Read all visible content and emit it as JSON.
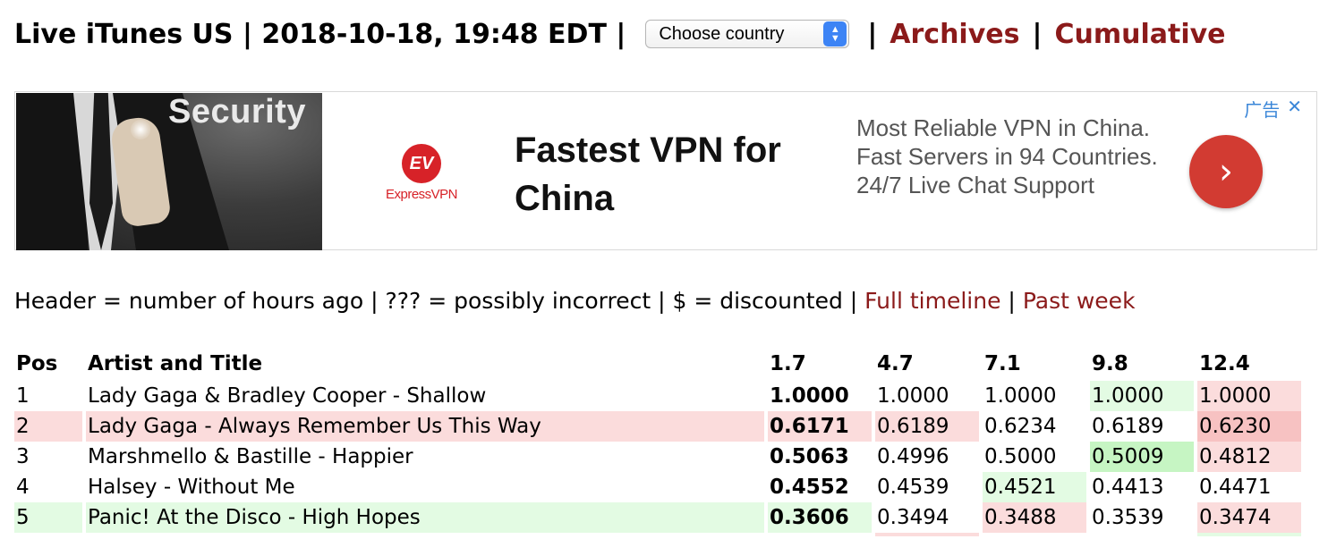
{
  "header": {
    "title": "Live iTunes US | 2018-10-18, 19:48 EDT |",
    "country_select": "Choose country",
    "sep": "|",
    "archives": "Archives",
    "cumulative": "Cumulative"
  },
  "ad": {
    "image_text": "Security",
    "brand_mark": "EV",
    "brand_name": "ExpressVPN",
    "headline": "Fastest VPN for China",
    "body": "Most Reliable VPN in China. Fast Servers in 94 Countries. 24/7 Live Chat Support",
    "cta_glyph": "›",
    "ad_label": "广告",
    "close_glyph": "✕"
  },
  "legend": {
    "text": "Header = number of hours ago | ??? = possibly incorrect | $ = discounted |",
    "full_timeline": "Full timeline",
    "sep": "|",
    "past_week": "Past week"
  },
  "table": {
    "headers": [
      "Pos",
      "Artist and Title",
      "1.7",
      "4.7",
      "7.1",
      "9.8",
      "12.4"
    ],
    "rows": [
      {
        "pos": "1",
        "title": "Lady Gaga & Bradley Cooper - Shallow",
        "values": [
          "1.0000",
          "1.0000",
          "1.0000",
          "1.0000",
          "1.0000"
        ]
      },
      {
        "pos": "2",
        "title": "Lady Gaga - Always Remember Us This Way",
        "values": [
          "0.6171",
          "0.6189",
          "0.6234",
          "0.6189",
          "0.6230"
        ]
      },
      {
        "pos": "3",
        "title": "Marshmello & Bastille - Happier",
        "values": [
          "0.5063",
          "0.4996",
          "0.5000",
          "0.5009",
          "0.4812"
        ]
      },
      {
        "pos": "4",
        "title": "Halsey - Without Me",
        "values": [
          "0.4552",
          "0.4539",
          "0.4521",
          "0.4413",
          "0.4471"
        ]
      },
      {
        "pos": "5",
        "title": "Panic! At the Disco - High Hopes",
        "values": [
          "0.3606",
          "0.3494",
          "0.3488",
          "0.3539",
          "0.3474"
        ]
      }
    ]
  },
  "colors": {
    "link": "#8b1a1a",
    "up_light": "#e3fbe3",
    "up_strong": "#c6f5c3",
    "down_light": "#fbdcdc",
    "down_strong": "#f7c2c2"
  }
}
